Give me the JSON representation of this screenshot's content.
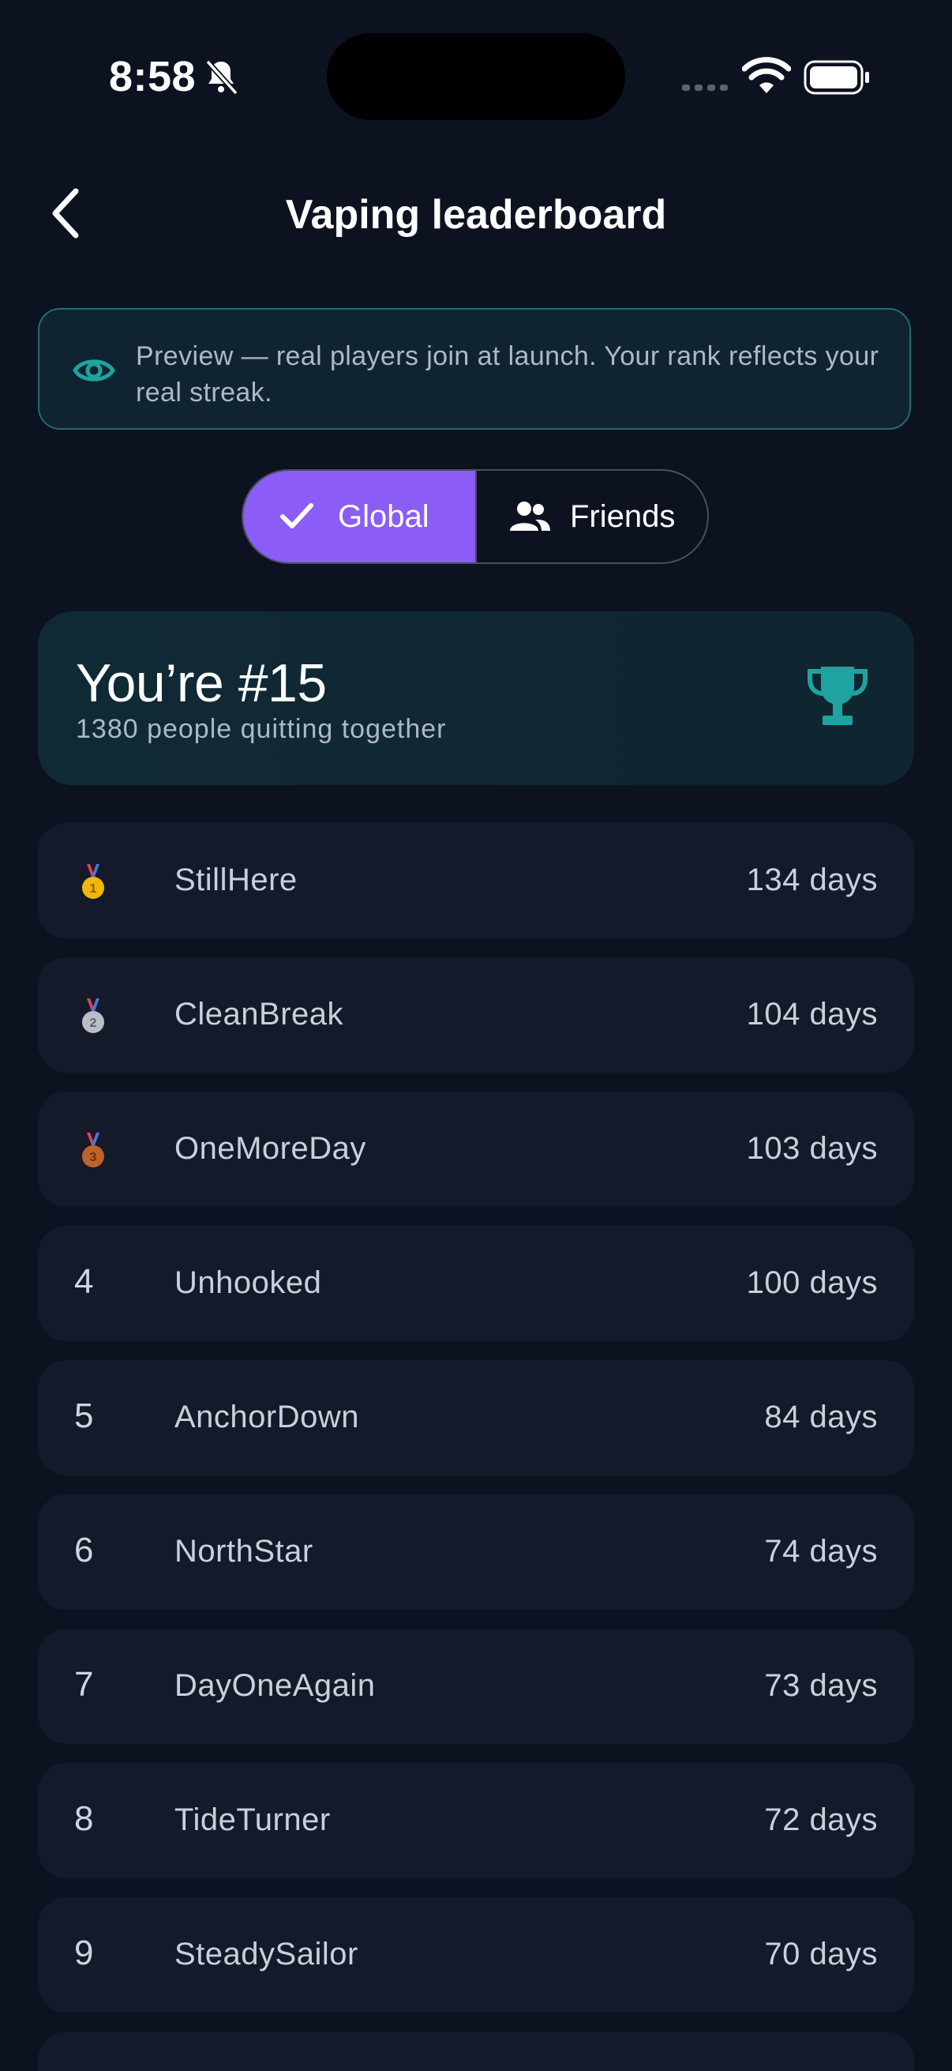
{
  "status_bar": {
    "time": "8:58"
  },
  "header": {
    "title": "Vaping leaderboard"
  },
  "banner": {
    "text": "Preview — real players join at launch. Your rank reflects your real streak."
  },
  "tabs": {
    "global": "Global",
    "friends": "Friends",
    "selected": "Global"
  },
  "rank_card": {
    "title": "You’re #15",
    "subtitle": "1380 people quitting together"
  },
  "leaderboard": [
    {
      "rank": "1",
      "medal": "gold",
      "name": "StillHere",
      "days": "134 days"
    },
    {
      "rank": "2",
      "medal": "silver",
      "name": "CleanBreak",
      "days": "104 days"
    },
    {
      "rank": "3",
      "medal": "bronze",
      "name": "OneMoreDay",
      "days": "103 days"
    },
    {
      "rank": "4",
      "name": "Unhooked",
      "days": "100 days"
    },
    {
      "rank": "5",
      "name": "AnchorDown",
      "days": "84 days"
    },
    {
      "rank": "6",
      "name": "NorthStar",
      "days": "74 days"
    },
    {
      "rank": "7",
      "name": "DayOneAgain",
      "days": "73 days"
    },
    {
      "rank": "8",
      "name": "TideTurner",
      "days": "72 days"
    },
    {
      "rank": "9",
      "name": "SteadySailor",
      "days": "70 days"
    }
  ],
  "colors": {
    "background": "#0c1220",
    "accent": "#8b5cf6",
    "teal": "#1fa3a0",
    "row": "#141a29"
  },
  "icons": [
    "bell-slash-icon",
    "signal-icon",
    "wifi-icon",
    "battery-icon",
    "back-chevron-icon",
    "eye-icon",
    "check-icon",
    "people-icon",
    "trophy-icon",
    "gold-medal-icon",
    "silver-medal-icon",
    "bronze-medal-icon"
  ]
}
